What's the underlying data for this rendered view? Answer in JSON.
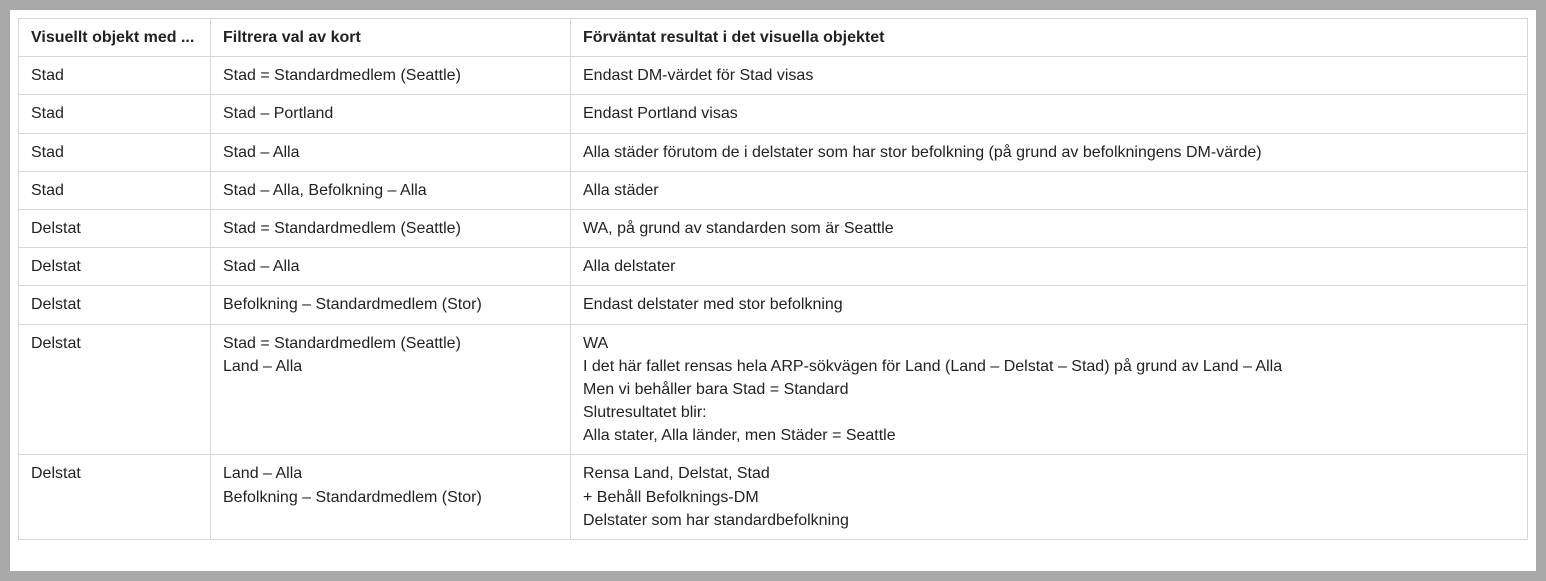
{
  "table": {
    "headers": [
      "Visuellt objekt med ...",
      "Filtrera val av kort",
      "Förväntat resultat i det visuella objektet"
    ],
    "rows": [
      {
        "visual": "Stad",
        "filter": [
          "Stad = Standardmedlem (Seattle)"
        ],
        "result": [
          "Endast DM-värdet för Stad visas"
        ]
      },
      {
        "visual": "Stad",
        "filter": [
          "Stad – Portland"
        ],
        "result": [
          "Endast Portland visas"
        ]
      },
      {
        "visual": "Stad",
        "filter": [
          "Stad – Alla"
        ],
        "result": [
          "Alla städer förutom de i delstater som har stor befolkning (på grund av befolkningens DM-värde)"
        ]
      },
      {
        "visual": "Stad",
        "filter": [
          "Stad – Alla, Befolkning – Alla"
        ],
        "result": [
          "Alla städer"
        ]
      },
      {
        "visual": "Delstat",
        "filter": [
          "Stad = Standardmedlem (Seattle)"
        ],
        "result": [
          "WA, på grund av standarden som är Seattle"
        ]
      },
      {
        "visual": "Delstat",
        "filter": [
          "Stad – Alla"
        ],
        "result": [
          "Alla delstater"
        ]
      },
      {
        "visual": "Delstat",
        "filter": [
          "Befolkning – Standardmedlem (Stor)"
        ],
        "result": [
          "Endast delstater med stor befolkning"
        ]
      },
      {
        "visual": "Delstat",
        "filter": [
          "Stad = Standardmedlem (Seattle)",
          "Land – Alla"
        ],
        "result": [
          "WA",
          "I det här fallet rensas hela ARP-sökvägen för Land (Land – Delstat – Stad) på grund av Land – Alla",
          "Men vi behåller bara Stad = Standard",
          "Slutresultatet blir:",
          "Alla stater, Alla länder, men Städer = Seattle"
        ]
      },
      {
        "visual": "Delstat",
        "filter": [
          "Land – Alla",
          "Befolkning – Standardmedlem (Stor)"
        ],
        "result": [
          "Rensa Land, Delstat, Stad",
          "+ Behåll Befolknings-DM",
          "Delstater som har standardbefolkning"
        ]
      }
    ]
  }
}
